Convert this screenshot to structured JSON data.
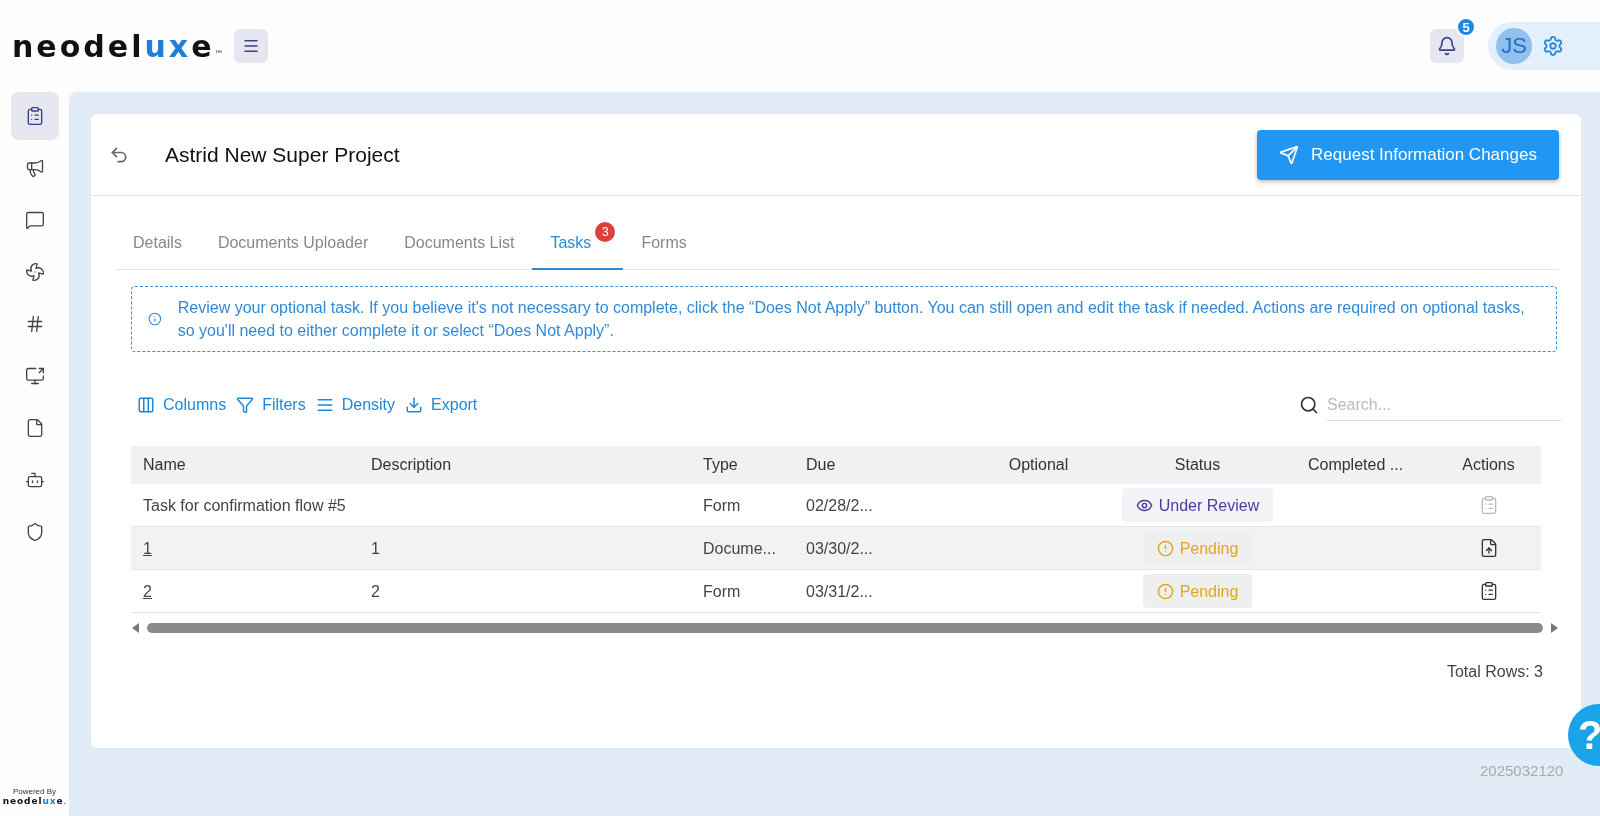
{
  "header": {
    "logo": {
      "prefix": "neodel",
      "highlight": "ux",
      "suffix": "e",
      "mark": "™"
    },
    "notifications": "5",
    "avatar": "JS"
  },
  "sidebar": {
    "items": [
      {
        "selected": true
      },
      {
        "selected": false
      },
      {
        "selected": false
      },
      {
        "selected": false
      },
      {
        "selected": false
      },
      {
        "selected": false
      },
      {
        "selected": false
      },
      {
        "selected": false
      },
      {
        "selected": false
      }
    ],
    "powered_by": "Powered By",
    "footer_logo": {
      "prefix": "neodel",
      "highlight": "ux",
      "suffix": "e",
      "mark": "."
    }
  },
  "project": {
    "title": "Astrid New Super Project",
    "request_button": "Request Information Changes"
  },
  "tabs": [
    {
      "label": "Details",
      "selected": false
    },
    {
      "label": "Documents Uploader",
      "selected": false
    },
    {
      "label": "Documents List",
      "selected": false
    },
    {
      "label": "Tasks",
      "selected": true,
      "badge": "3"
    },
    {
      "label": "Forms",
      "selected": false
    }
  ],
  "notice": "Review your optional task. If you believe it's not necessary to complete, click the “Does Not Apply” button. You can still open and edit the task if needed. Actions are required on optional tasks, so you'll need to either complete it or select “Does Not Apply”.",
  "toolbar": [
    {
      "kind": "columns",
      "label": "Columns"
    },
    {
      "kind": "filters",
      "label": "Filters"
    },
    {
      "kind": "density",
      "label": "Density"
    },
    {
      "kind": "export",
      "label": "Export"
    }
  ],
  "search": {
    "placeholder": "Search..."
  },
  "table": {
    "columns": [
      "Name",
      "Description",
      "Type",
      "Due",
      "Optional",
      "Status",
      "Completed ...",
      "Actions"
    ],
    "rows": [
      {
        "name": "Task for confirmation flow #5",
        "linked": false,
        "description": "",
        "type": "Form",
        "due": "02/28/2...",
        "status": {
          "kind": "review",
          "label": "Under Review"
        },
        "action": {
          "kind": "form",
          "disabled": true
        },
        "highlighted": false
      },
      {
        "name": "1",
        "linked": true,
        "description": "1",
        "type": "Docume...",
        "due": "03/30/2...",
        "status": {
          "kind": "pending",
          "label": "Pending"
        },
        "action": {
          "kind": "upload",
          "disabled": false
        },
        "highlighted": true
      },
      {
        "name": "2",
        "linked": true,
        "description": "2",
        "type": "Form",
        "due": "03/31/2...",
        "status": {
          "kind": "pending",
          "label": "Pending"
        },
        "action": {
          "kind": "form",
          "disabled": false
        },
        "highlighted": false
      }
    ]
  },
  "total_rows": "Total Rows: 3",
  "help": "?",
  "version": "2025032120"
}
